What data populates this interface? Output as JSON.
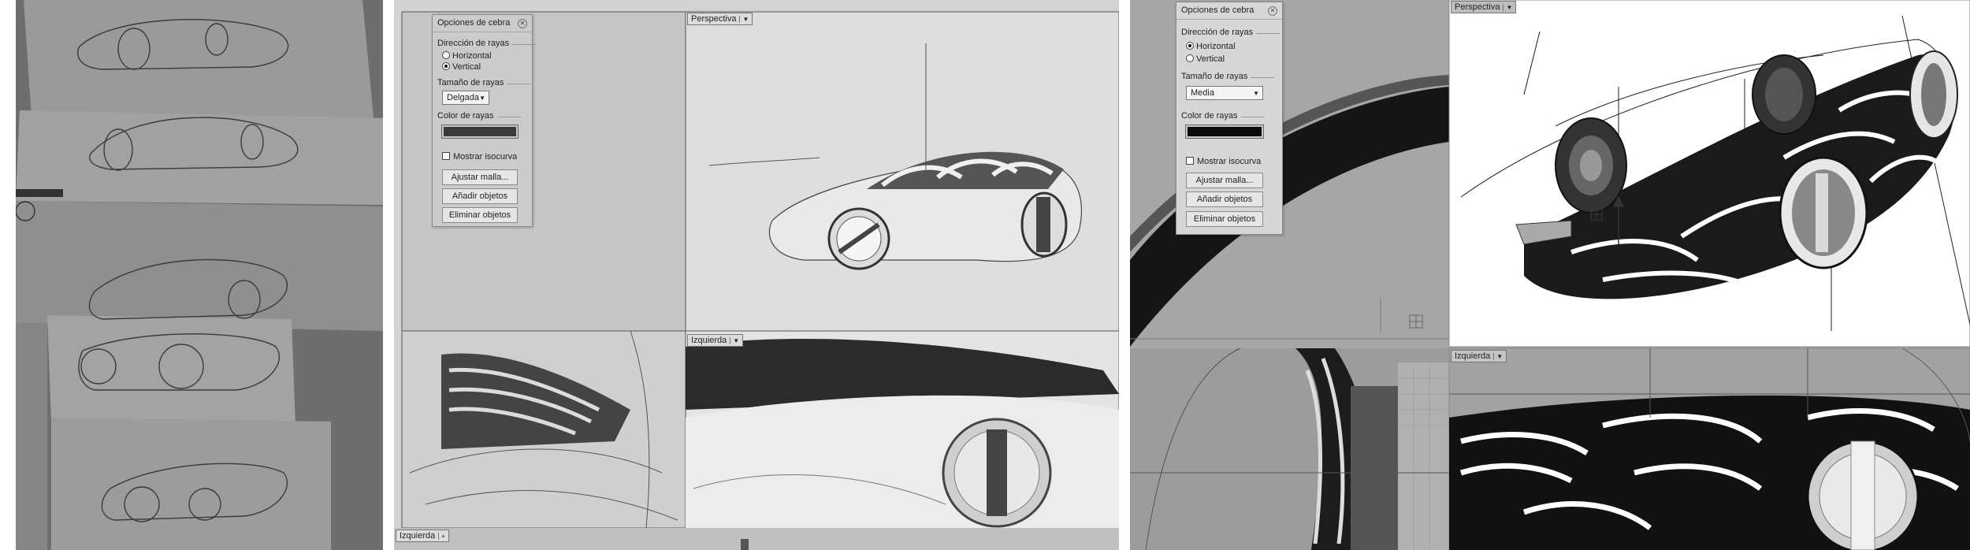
{
  "panel_1": {
    "dialog": {
      "title": "Opciones de cebra",
      "direction_label": "Dirección de rayas",
      "direction_options": [
        "Horizontal",
        "Vertical"
      ],
      "direction_selected": "Vertical",
      "size_label": "Tamaño de rayas",
      "size_value": "Delgada",
      "color_label": "Color de rayas",
      "color_value": "#3a3a3a",
      "isocurve_label": "Mostrar isocurva",
      "buttons": [
        "Ajustar malla...",
        "Añadir objetos",
        "Eliminar objetos"
      ]
    },
    "viewports": {
      "perspective_label": "Perspectiva",
      "left_label": "Izquierda",
      "bottom_tab_label": "Izquierda"
    }
  },
  "panel_2": {
    "dialog": {
      "title": "Opciones de cebra",
      "direction_label": "Dirección de rayas",
      "direction_options": [
        "Horizontal",
        "Vertical"
      ],
      "direction_selected": "Horizontal",
      "size_label": "Tamaño de rayas",
      "size_value": "Media",
      "color_label": "Color de rayas",
      "color_value": "#0a0a0a",
      "isocurve_label": "Mostrar isocurva",
      "buttons": [
        "Ajustar malla...",
        "Añadir objetos",
        "Eliminar objetos"
      ]
    },
    "viewports": {
      "perspective_label": "Perspectiva",
      "left_label": "Izquierda"
    }
  },
  "icons": [
    "close-icon",
    "dropdown-arrow-icon",
    "gumball-axis-icon",
    "grid-icon"
  ]
}
